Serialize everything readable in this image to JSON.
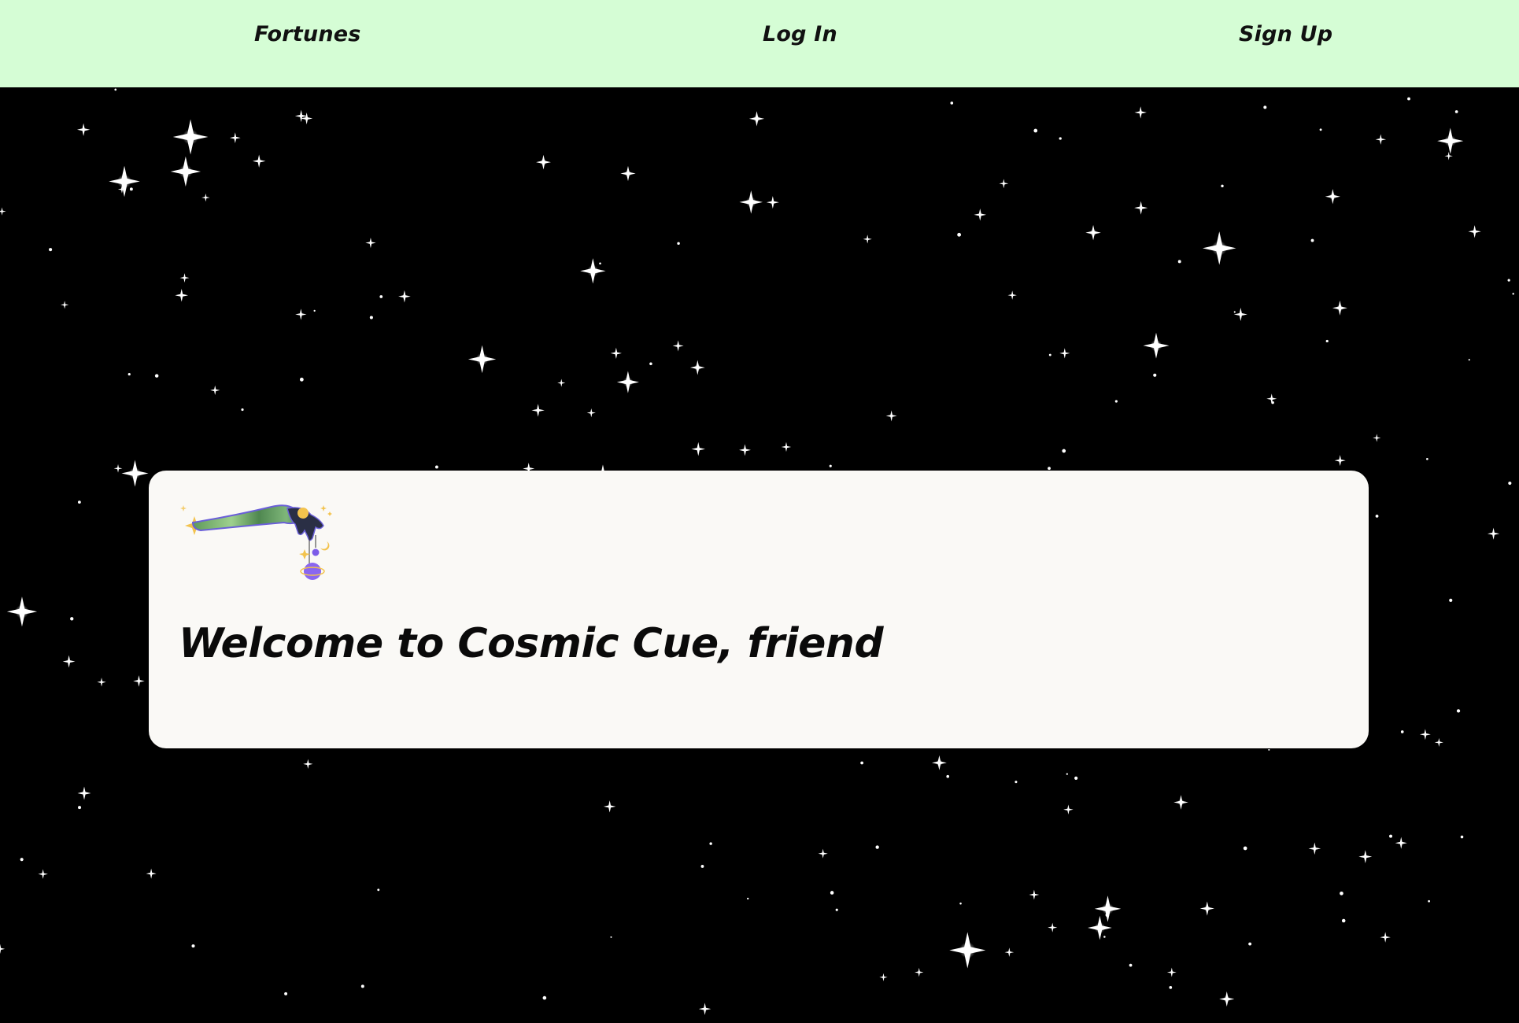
{
  "colors": {
    "nav_background": "#d5fdd5",
    "nav_text": "#111111",
    "page_background": "#000000",
    "card_background": "#faf9f6",
    "heading_text": "#0a0a0a",
    "star": "#ffffff"
  },
  "nav": {
    "items": [
      {
        "label": "Fortunes"
      },
      {
        "label": "Log In"
      },
      {
        "label": "Sign Up"
      }
    ]
  },
  "background": {
    "icon": "starfield"
  },
  "welcome": {
    "logo_icon": "cosmic-hand-logo-icon",
    "heading": "Welcome to Cosmic Cue, friend"
  }
}
